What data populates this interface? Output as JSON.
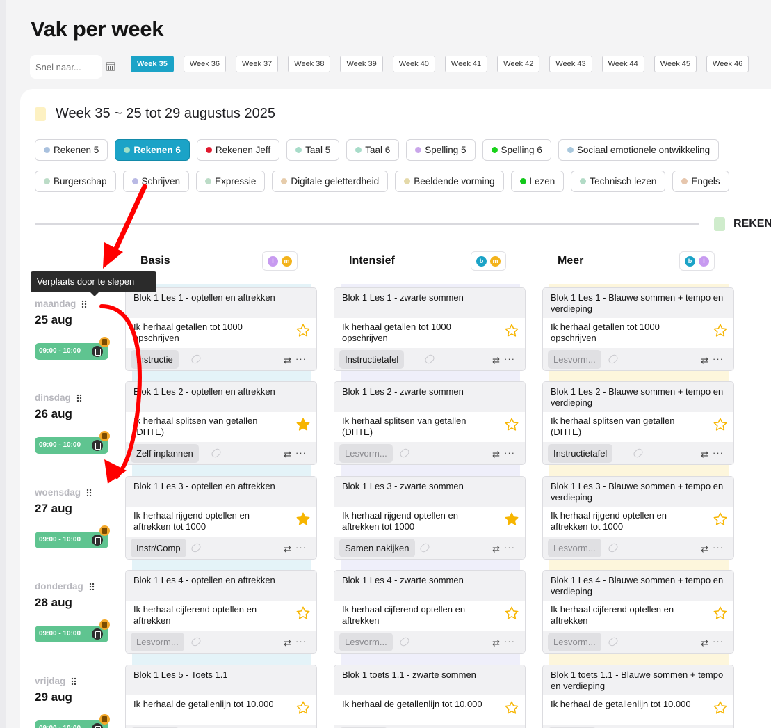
{
  "page": {
    "title": "Vak per week"
  },
  "search": {
    "placeholder": "Snel naar..."
  },
  "weeks": [
    "Week 35",
    "Week 36",
    "Week 37",
    "Week 38",
    "Week 39",
    "Week 40",
    "Week 41",
    "Week 42",
    "Week 43",
    "Week 44",
    "Week 45",
    "Week 46"
  ],
  "active_week": "Week 35",
  "week_header": "Week 35 ~ 25 tot 29 augustus 2025",
  "subjects_row1": [
    {
      "label": "Rekenen 5",
      "color": "#a9c1de"
    },
    {
      "label": "Rekenen 6",
      "color": "#9fe0c8",
      "active": true
    },
    {
      "label": "Rekenen Jeff",
      "color": "#e0182d"
    },
    {
      "label": "Taal 5",
      "color": "#a8dcc9"
    },
    {
      "label": "Taal 6",
      "color": "#a8dcc9"
    },
    {
      "label": "Spelling 5",
      "color": "#c9a6ea"
    },
    {
      "label": "Spelling 6",
      "color": "#19d21a"
    },
    {
      "label": "Sociaal emotionele ontwikkeling",
      "color": "#a9c8dd"
    }
  ],
  "subjects_row2": [
    {
      "label": "Burgerschap",
      "color": "#bcdcc7"
    },
    {
      "label": "Schrijven",
      "color": "#b9b9e4"
    },
    {
      "label": "Expressie",
      "color": "#bcdcc7"
    },
    {
      "label": "Digitale geletterdheid",
      "color": "#e6ccab"
    },
    {
      "label": "Beeldende vorming",
      "color": "#e4d9a9"
    },
    {
      "label": "Lezen",
      "color": "#12c81a"
    },
    {
      "label": "Technisch lezen",
      "color": "#b2dbc6"
    },
    {
      "label": "Engels",
      "color": "#e6c6ad"
    }
  ],
  "section_label": "REKEN",
  "tooltip": "Verplaats door te slepen",
  "columns": [
    {
      "name": "Basis",
      "badges": [
        {
          "t": "l",
          "c": "#c79af0"
        },
        {
          "t": "m",
          "c": "#f3b31c"
        }
      ],
      "stripe": "#e4f3f8"
    },
    {
      "name": "Intensief",
      "badges": [
        {
          "t": "b",
          "c": "#1ba3c7"
        },
        {
          "t": "m",
          "c": "#f3b31c"
        }
      ],
      "stripe": "#efeffa"
    },
    {
      "name": "Meer",
      "badges": [
        {
          "t": "b",
          "c": "#1ba3c7"
        },
        {
          "t": "l",
          "c": "#c79af0"
        }
      ],
      "stripe": "#fdf6dc"
    }
  ],
  "days": [
    {
      "name": "maandag",
      "date": "25 aug",
      "time": "09:00 - 10:00"
    },
    {
      "name": "dinsdag",
      "date": "26 aug",
      "time": "09:00 - 10:00"
    },
    {
      "name": "woensdag",
      "date": "27 aug",
      "time": "09:00 - 10:00"
    },
    {
      "name": "donderdag",
      "date": "28 aug",
      "time": "09:00 - 10:00"
    },
    {
      "name": "vrijdag",
      "date": "29 aug",
      "time": "09:00 - 10:00"
    }
  ],
  "cards": [
    [
      {
        "title": "Blok 1 Les 1 - optellen en aftrekken",
        "goal": "Ik herhaal getallen tot 1000 opschrijven",
        "work": "Instructie",
        "ph": false,
        "starred": false
      },
      {
        "title": "Blok 1 Les 1 - zwarte sommen",
        "goal": "Ik herhaal getallen tot 1000 opschrijven",
        "work": "Instructietafel",
        "ph": false,
        "starred": false
      },
      {
        "title": "Blok 1 Les 1 - Blauwe sommen + tempo en verdieping",
        "goal": "Ik herhaal getallen tot 1000 opschrijven",
        "work": "Lesvorm...",
        "ph": true,
        "starred": false
      }
    ],
    [
      {
        "title": "Blok 1 Les 2 - optellen en aftrekken",
        "goal": "Ik herhaal splitsen van getallen (DHTE)",
        "work": "Zelf inplannen",
        "ph": false,
        "starred": true
      },
      {
        "title": "Blok 1 Les 2 - zwarte sommen",
        "goal": "Ik herhaal splitsen van getallen (DHTE)",
        "work": "Lesvorm...",
        "ph": true,
        "starred": false
      },
      {
        "title": "Blok 1 Les 2 - Blauwe sommen + tempo en verdieping",
        "goal": "Ik herhaal splitsen van getallen (DHTE)",
        "work": "Instructietafel",
        "ph": false,
        "starred": false
      }
    ],
    [
      {
        "title": "Blok 1 Les 3 - optellen en aftrekken",
        "goal": "Ik herhaal rijgend optellen en aftrekken tot 1000",
        "work": "Instr/Comp",
        "ph": false,
        "starred": true
      },
      {
        "title": "Blok 1 Les 3 - zwarte sommen",
        "goal": "Ik herhaal rijgend optellen en aftrekken tot 1000",
        "work": "Samen nakijken",
        "ph": false,
        "starred": true
      },
      {
        "title": "Blok 1 Les 3 - Blauwe sommen + tempo en verdieping",
        "goal": "Ik herhaal rijgend optellen en aftrekken tot 1000",
        "work": "Lesvorm...",
        "ph": true,
        "starred": false
      }
    ],
    [
      {
        "title": "Blok 1 Les 4 - optellen en aftrekken",
        "goal": "Ik herhaal cijferend optellen en aftrekken",
        "work": "Lesvorm...",
        "ph": true,
        "starred": false
      },
      {
        "title": "Blok 1 Les 4 - zwarte sommen",
        "goal": "Ik herhaal cijferend optellen en aftrekken",
        "work": "Lesvorm...",
        "ph": true,
        "starred": false
      },
      {
        "title": "Blok 1 Les 4 - Blauwe sommen + tempo en verdieping",
        "goal": "Ik herhaal cijferend optellen en aftrekken",
        "work": "Lesvorm...",
        "ph": true,
        "starred": false
      }
    ],
    [
      {
        "title": "Blok 1 Les 5 - Toets 1.1",
        "goal": "Ik herhaal de getallenlijn tot 10.000",
        "work": "",
        "ph": true,
        "starred": false
      },
      {
        "title": "Blok 1 toets 1.1 - zwarte sommen",
        "goal": "Ik herhaal de getallenlijn tot 10.000",
        "work": "",
        "ph": true,
        "starred": false
      },
      {
        "title": "Blok 1 toets 1.1 - Blauwe sommen + tempo en verdieping",
        "goal": "Ik herhaal de getallenlijn tot 10.000",
        "work": "",
        "ph": true,
        "starred": false
      }
    ]
  ],
  "icons": {
    "star": "star-icon",
    "link": "link-icon",
    "swap": "swap-icon",
    "more": "more-icon",
    "calendar": "calendar-icon",
    "grip": "grip-icon"
  }
}
